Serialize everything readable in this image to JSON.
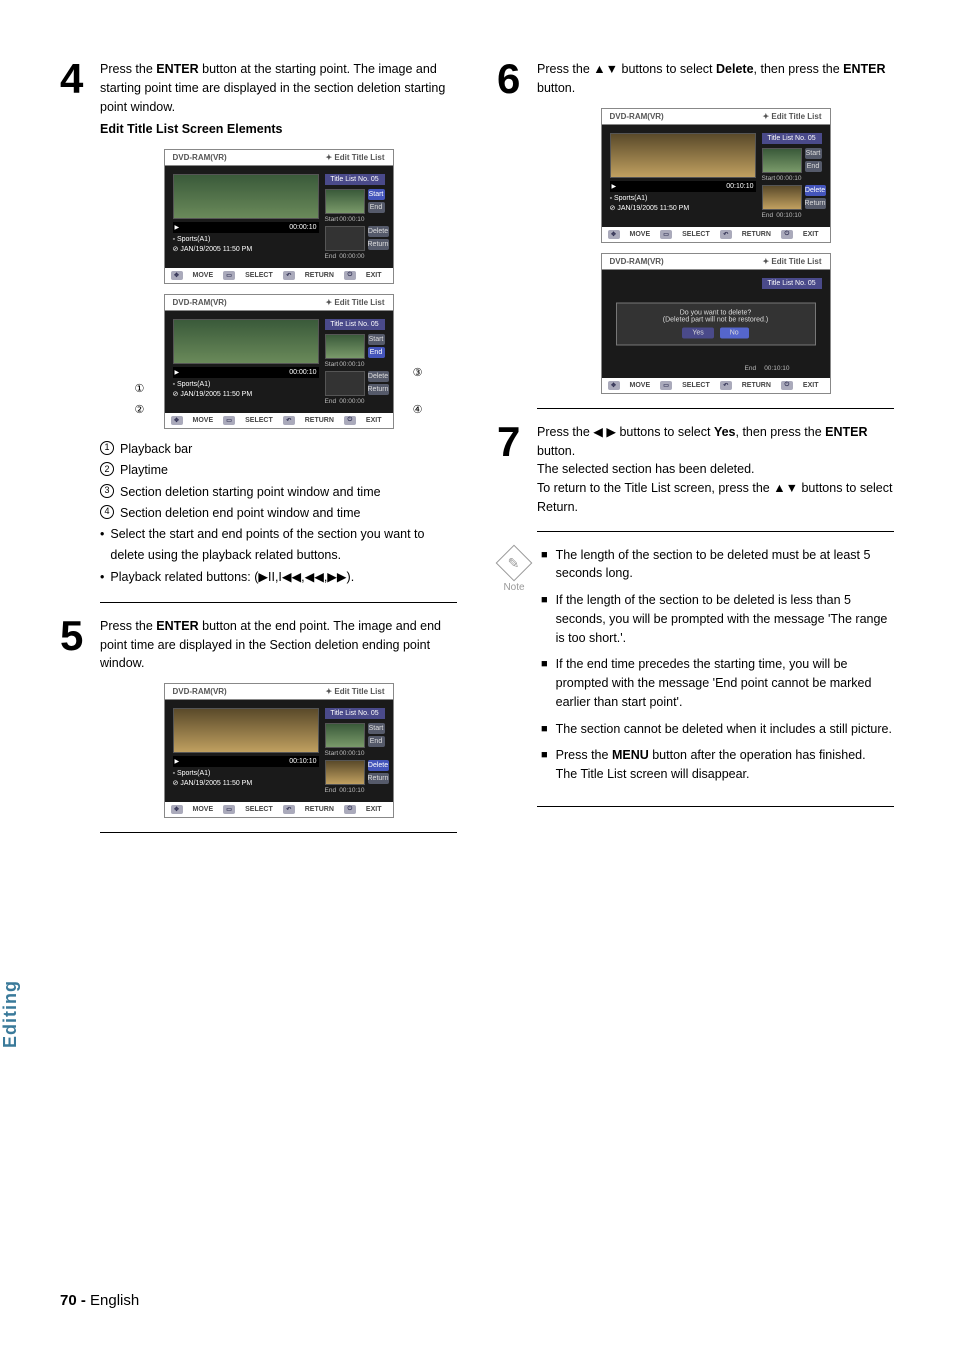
{
  "side_tab": "Editing",
  "page_footer": {
    "num": "70 -",
    "lang": "English"
  },
  "left": {
    "step4": {
      "num": "4",
      "l1a": "Press the ",
      "l1b": "ENTER",
      "l1c": " button at the starting point.",
      "l2": "The image and starting point time are displayed in the section deletion starting point window.",
      "sub": "Edit Title List Screen Elements"
    },
    "screenA": {
      "hdr_l": "DVD-RAM(VR)",
      "hdr_r": "✦  Edit Title List",
      "title_no": "Title List No. 05",
      "btn_start": "Start",
      "btn_end": "End",
      "btn_delete": "Delete",
      "btn_return": "Return",
      "lbl_start": "Start",
      "t_start": "00:00:10",
      "lbl_end": "End",
      "t_end": "00:00:00",
      "bar_time": "00:00:10",
      "meta1": "Sports(A1)",
      "meta2": "JAN/19/2005 11:50 PM",
      "f1": "MOVE",
      "f2": "SELECT",
      "f3": "RETURN",
      "f4": "EXIT"
    },
    "markers": {
      "m1": "①",
      "m2": "②",
      "m3": "③",
      "m4": "④"
    },
    "screenB": {
      "hdr_l": "DVD-RAM(VR)",
      "hdr_r": "✦  Edit Title List",
      "title_no": "Title List No. 05",
      "btn_start": "Start",
      "btn_end": "End",
      "btn_delete": "Delete",
      "btn_return": "Return",
      "lbl_start": "Start",
      "t_start": "00:00:10",
      "lbl_end": "End",
      "t_end": "00:00:00",
      "bar_time": "00:00:10",
      "meta1": "Sports(A1)",
      "meta2": "JAN/19/2005 11:50 PM",
      "f1": "MOVE",
      "f2": "SELECT",
      "f3": "RETURN",
      "f4": "EXIT"
    },
    "legend": {
      "r1": "Playback bar",
      "r2": "Playtime",
      "r3": "Section deletion starting point window and time",
      "r4": "Section deletion end point window and time",
      "b1": "Select the start and end points of the section you want to delete using the playback related buttons.",
      "b2a": "Playback related buttons: (",
      "b2b": "▶II,I◀◀,◀◀,▶▶",
      "b2c": ")."
    },
    "step5": {
      "num": "5",
      "l1a": "Press the ",
      "l1b": "ENTER",
      "l1c": " button at the end point.",
      "l2": "The image and end point time are displayed in the Section deletion ending point window."
    },
    "screenC": {
      "hdr_l": "DVD-RAM(VR)",
      "hdr_r": "✦  Edit Title List",
      "title_no": "Title List No. 05",
      "btn_start": "Start",
      "btn_end": "End",
      "btn_delete": "Delete",
      "btn_return": "Return",
      "lbl_start": "Start",
      "t_start": "00:00:10",
      "lbl_end": "End",
      "t_end": "00:10:10",
      "bar_time": "00:10:10",
      "meta1": "Sports(A1)",
      "meta2": "JAN/19/2005 11:50 PM",
      "f1": "MOVE",
      "f2": "SELECT",
      "f3": "RETURN",
      "f4": "EXIT"
    }
  },
  "right": {
    "step6": {
      "num": "6",
      "l1a": "Press the ▲▼ buttons to select ",
      "l1b": "Delete",
      "l1c": ", then press the ",
      "l1d": "ENTER",
      "l1e": " button."
    },
    "screenD": {
      "hdr_l": "DVD-RAM(VR)",
      "hdr_r": "✦  Edit Title List",
      "title_no": "Title List No. 05",
      "btn_start": "Start",
      "btn_end": "End",
      "btn_delete": "Delete",
      "btn_return": "Return",
      "lbl_start": "Start",
      "t_start": "00:00:10",
      "lbl_end": "End",
      "t_end": "00:10:10",
      "bar_time": "00:10:10",
      "meta1": "Sports(A1)",
      "meta2": "JAN/19/2005 11:50 PM",
      "f1": "MOVE",
      "f2": "SELECT",
      "f3": "RETURN",
      "f4": "EXIT"
    },
    "screenE": {
      "hdr_l": "DVD-RAM(VR)",
      "hdr_r": "✦  Edit Title List",
      "title_no": "Title List No. 05",
      "dialog_l1": "Do you want to delete?",
      "dialog_l2": "(Deleted part will not be restored.)",
      "yes": "Yes",
      "no": "No",
      "lbl_end": "End",
      "t_end": "00:10:10",
      "f1": "MOVE",
      "f2": "SELECT",
      "f3": "RETURN",
      "f4": "EXIT"
    },
    "step7": {
      "num": "7",
      "l1a": "Press the ◀ ▶ buttons to select ",
      "l1b": "Yes",
      "l1c": ", then press the ",
      "l1d": "ENTER",
      "l1e": " button.",
      "l2": "The selected section has been deleted.",
      "l3": "To return to the Title List screen, press the ▲▼ buttons to select Return."
    },
    "note_label": "Note",
    "notes": {
      "n1": "The length of the section to be deleted must be at least 5 seconds long.",
      "n2": "If the length of the section to be deleted is less than 5 seconds, you will be prompted with the message 'The range is too short.'.",
      "n3": "If the end time precedes the starting time, you will be prompted with the message 'End point cannot be marked earlier than start point'.",
      "n4": "The section cannot be deleted when it includes a still picture.",
      "n5a": "Press the ",
      "n5b": "MENU",
      "n5c": " button after the operation has finished.",
      "n5d": "The Title List screen will disappear."
    }
  }
}
